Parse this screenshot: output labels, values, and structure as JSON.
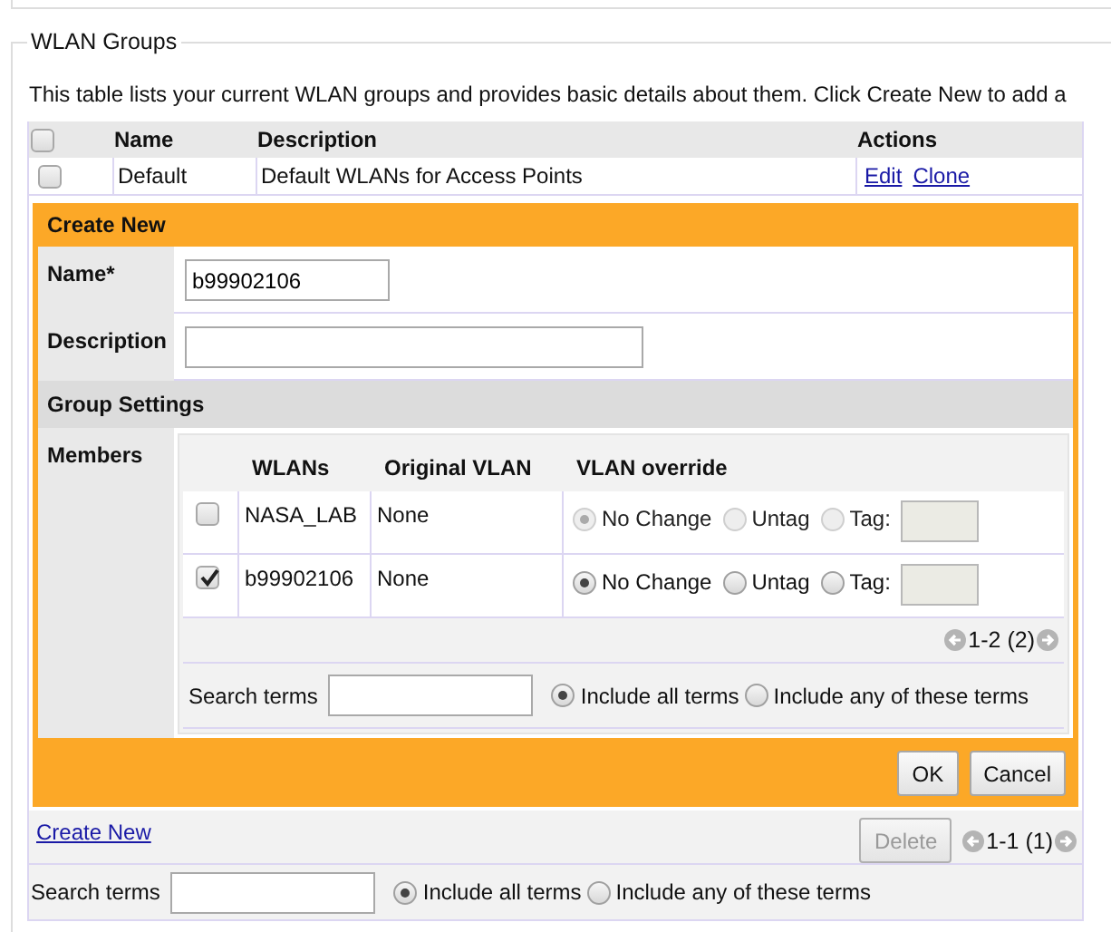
{
  "section": {
    "title": "WLAN Groups",
    "intro": "This table lists your current WLAN groups and provides basic details about them. Click Create New to add a"
  },
  "groups_table": {
    "select_all": false,
    "columns": [
      "Name",
      "Description",
      "Actions"
    ],
    "rows": [
      {
        "checked": false,
        "name": "Default",
        "description": "Default WLANs for Access Points",
        "actions": [
          "Edit",
          "Clone"
        ]
      }
    ]
  },
  "create_panel": {
    "title": "Create New",
    "fields": [
      {
        "label": "Name*",
        "value": "b99902106"
      },
      {
        "label": "Description"
      }
    ],
    "group_settings": "Group Settings",
    "members_label": "Members",
    "members": {
      "columns": [
        "WLANs",
        "Original VLAN",
        "VLAN override"
      ],
      "rows": [
        {
          "checked": false,
          "wlan": "NASA_LAB",
          "original_vlan": "None",
          "disabled": true,
          "options": [
            {
              "label": "No Change",
              "selected": true
            },
            {
              "label": "Untag",
              "selected": false
            },
            {
              "label": "Tag:",
              "selected": false
            }
          ]
        },
        {
          "checked": true,
          "wlan": "b99902106",
          "original_vlan": "None",
          "disabled": false,
          "options": [
            {
              "label": "No Change",
              "selected": true
            },
            {
              "label": "Untag",
              "selected": false
            },
            {
              "label": "Tag:",
              "selected": false
            }
          ]
        }
      ],
      "pager": "1-2 (2)",
      "search": {
        "label": "Search terms",
        "options": [
          {
            "label": "Include all terms",
            "selected": true
          },
          {
            "label": "Include any of these terms",
            "selected": false
          }
        ]
      }
    },
    "buttons": [
      "OK",
      "Cancel"
    ]
  },
  "footer": {
    "create_link": "Create New",
    "delete_button": {
      "label": "Delete",
      "disabled": true
    },
    "pager": "1-1 (1)",
    "search": {
      "label": "Search terms",
      "options": [
        {
          "label": "Include all terms",
          "selected": true
        },
        {
          "label": "Include any of these terms",
          "selected": false
        }
      ]
    }
  }
}
